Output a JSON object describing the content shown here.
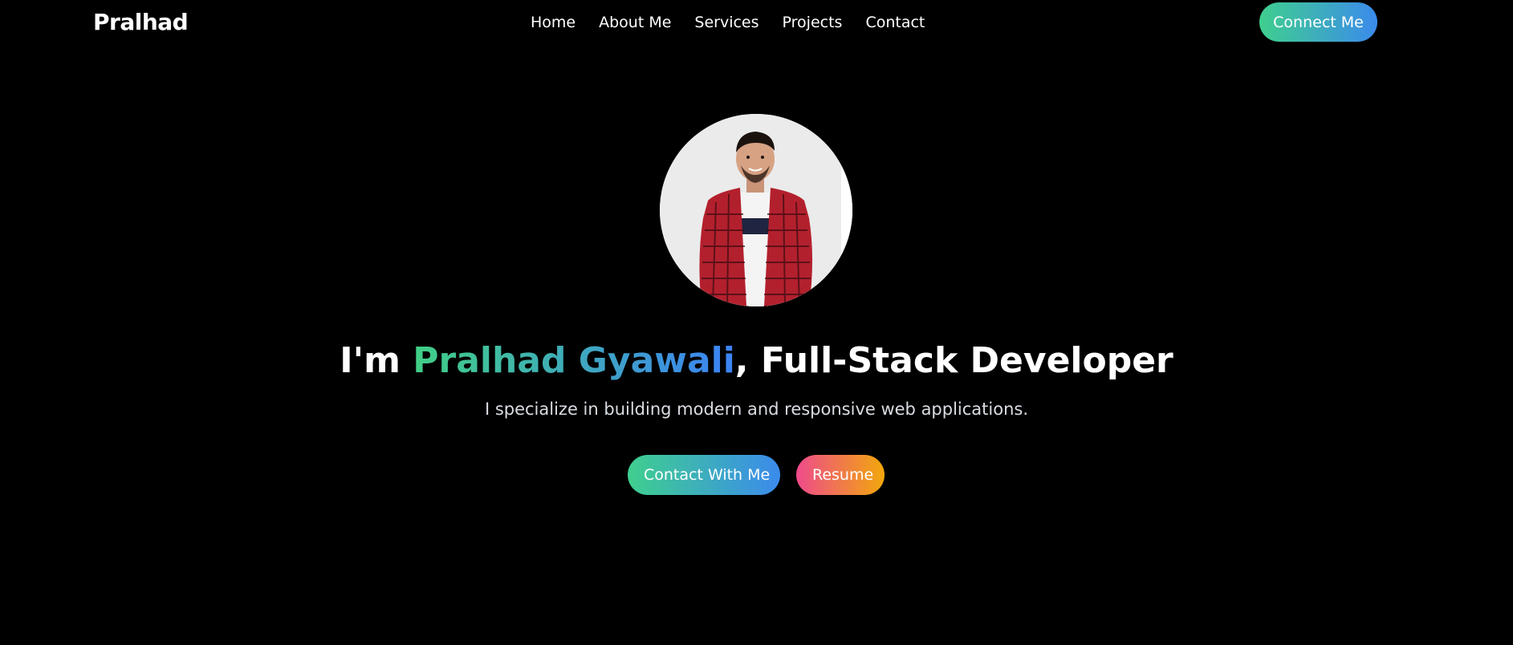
{
  "header": {
    "brand": "Pralhad",
    "nav": [
      {
        "label": "Home"
      },
      {
        "label": "About Me"
      },
      {
        "label": "Services"
      },
      {
        "label": "Projects"
      },
      {
        "label": "Contact"
      }
    ],
    "connect_label": "Connect Me"
  },
  "hero": {
    "headline_prefix": "I'm ",
    "name": "Pralhad Gyawali",
    "headline_suffix": ", Full-Stack Developer",
    "subtitle": "I specialize in building modern and responsive web applications.",
    "contact_label": "Contact With Me",
    "resume_label": "Resume"
  },
  "colors": {
    "background": "#000000",
    "green_accent": "#3fcf8e",
    "blue_accent": "#3b82f6",
    "pink_accent": "#ee4b8b",
    "orange_accent": "#f2a80c"
  }
}
